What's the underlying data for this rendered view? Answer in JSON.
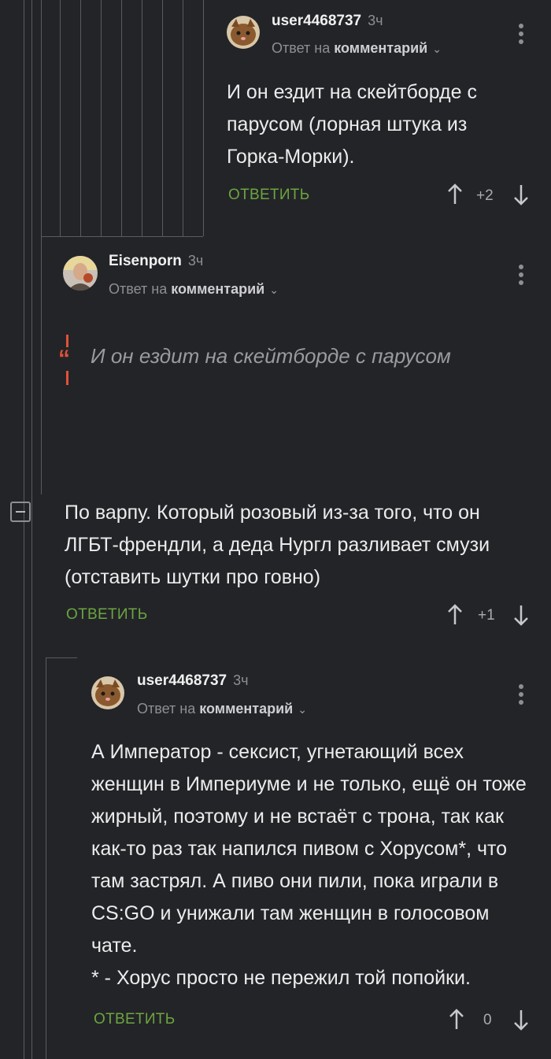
{
  "comments": [
    {
      "username": "user4468737",
      "time": "3ч",
      "reply_prefix": "Ответ на",
      "reply_target": "комментарий",
      "text": "И он ездит на скейтборде с парусом (лорная штука из Горка-Морки).",
      "reply_label": "ОТВЕТИТЬ",
      "rating": "+2"
    },
    {
      "username": "Eisenporn",
      "time": "3ч",
      "reply_prefix": "Ответ на",
      "reply_target": "комментарий",
      "quote": "И он ездит на скейтборде с парусом",
      "text": "По варпу. Который розовый из-за того, что он ЛГБТ-френдли, а деда Нургл разливает смузи (отставить шутки про говно)",
      "reply_label": "ОТВЕТИТЬ",
      "rating": "+1"
    },
    {
      "username": "user4468737",
      "time": "3ч",
      "reply_prefix": "Ответ на",
      "reply_target": "комментарий",
      "text": "А Император - сексист, угнетающий всех женщин в Империуме и не только, ещё он тоже жирный, поэтому и не встаёт с трона, так как как-то раз так напился пивом с Хорусом*, что там застрял. А пиво они пили, пока играли в CS:GO и унижали там женщин в голосовом чате.\n* - Хорус просто не пережил той попойки.",
      "reply_label": "ОТВЕТИТЬ",
      "rating": "0"
    }
  ],
  "colors": {
    "background": "#232428",
    "reply_green": "#6ca53f",
    "thread_line": "#5a5b5f",
    "quote_mark": "#e0523a"
  },
  "icons": [
    "avatar-cat",
    "avatar-man",
    "more-vertical-icon",
    "chevron-down-icon",
    "arrow-up-icon",
    "arrow-down-icon",
    "quote-icon",
    "collapse-icon"
  ]
}
